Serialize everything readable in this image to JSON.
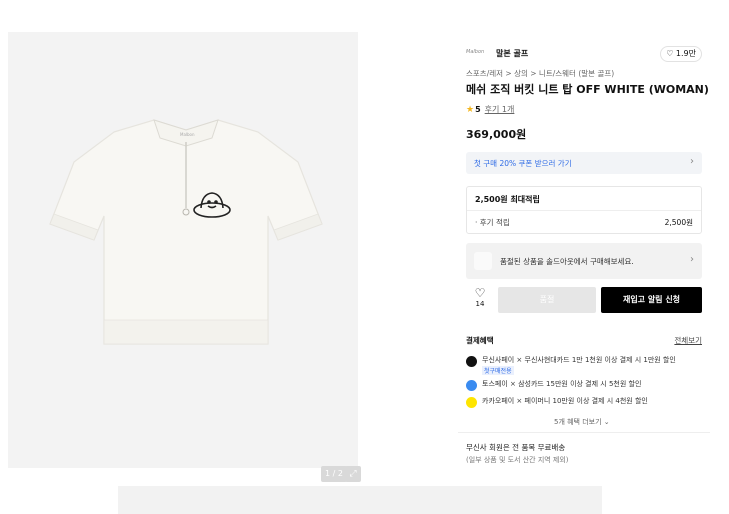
{
  "brand": {
    "logo_text": "Malbon",
    "name": "말본 골프",
    "likes": "1.9만"
  },
  "breadcrumb": "스포츠/레저 > 상의 > 니트/스웨터 (말본 골프)",
  "product": {
    "title": "메쉬 조직 버킷 니트 탑 OFF WHITE (WOMAN)",
    "rating": "5",
    "reviews": "후기 1개",
    "price": "369,000원"
  },
  "gallery": {
    "page_indicator": "1 / 2"
  },
  "coupon": {
    "text": "첫 구매 20% 쿠폰 받으러 가기"
  },
  "points": {
    "max": "2,500원 최대적립",
    "review_label": "· 후기 적립",
    "review_value": "2,500원"
  },
  "soldout": {
    "text": "품절된 상품을 솔드아웃에서 구매해보세요."
  },
  "actions": {
    "wish_count": "14",
    "buy_label": "품절",
    "notify_label": "재입고 알림 신청"
  },
  "benefits": {
    "heading": "결제혜택",
    "view_all": "전체보기",
    "items": [
      {
        "text": "무신사페이 × 무신사현대카드 1만 1천원 이상 결제 시 1만원 할인",
        "badge": "첫구매전용",
        "icon_color": "#111111"
      },
      {
        "text": "토스페이 × 삼성카드 15만원 이상 결제 시 5천원 할인",
        "icon_color": "#3a8bf0"
      },
      {
        "text": "카카오페이 × 페이머니 10만원 이상 결제 시 4천원 할인",
        "icon_color": "#fee500"
      }
    ],
    "more": "5개 혜택 더보기"
  },
  "shipping": {
    "text": "무신사 회원은 전 품목 무료배송",
    "note": "(일부 상품 및 도서 산간 지역 제외)"
  }
}
